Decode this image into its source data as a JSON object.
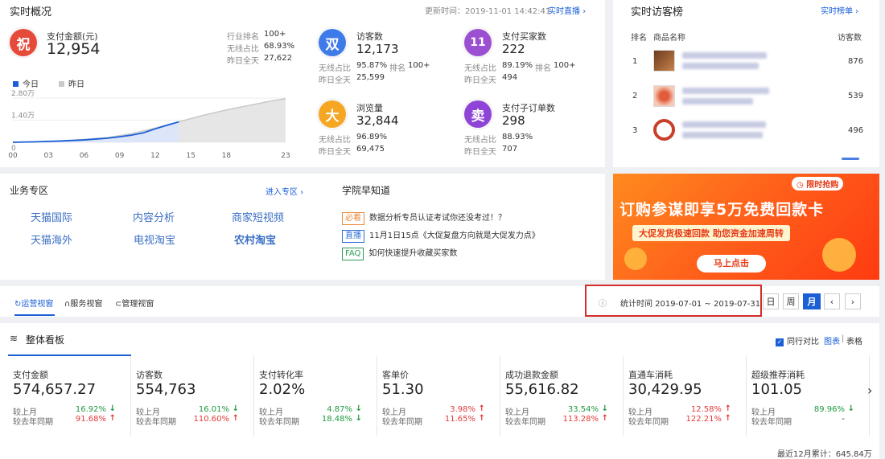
{
  "realtime": {
    "title": "实时概况",
    "updated": "更新时间：2019-11-01 14:42:41",
    "live_link": "实时直播",
    "pay_amount_label": "支付金额(元)",
    "pay_amount_value": "12,954",
    "industry_rank_label": "行业排名",
    "industry_rank_value": "100+",
    "wireless_label": "无线占比",
    "wireless_value": "68.93%",
    "yesterday_label": "昨日全天",
    "yesterday_value": "27,622",
    "legend_today": "今日",
    "legend_yesterday": "昨日",
    "y_ticks": [
      "2.80万",
      "1.40万",
      "0"
    ],
    "x_ticks": [
      "00",
      "03",
      "06",
      "09",
      "12",
      "15",
      "18",
      "23"
    ],
    "metrics": [
      {
        "badge": "双",
        "badge_color": "#3f7be8",
        "label": "访客数",
        "value": "12,173",
        "wl": "无线占比",
        "wv": "95.87%",
        "rl": "排名",
        "rv": "100+",
        "yl": "昨日全天",
        "yv": "25,599"
      },
      {
        "badge": "11",
        "badge_color": "#9b4fd1",
        "label": "支付买家数",
        "value": "222",
        "wl": "无线占比",
        "wv": "89.19%",
        "rl": "排名",
        "rv": "100+",
        "yl": "昨日全天",
        "yv": "494"
      },
      {
        "badge": "大",
        "badge_color": "#f5a623",
        "label": "浏览量",
        "value": "32,844",
        "wl": "无线占比",
        "wv": "96.89%",
        "rl": "",
        "rv": "",
        "yl": "昨日全天",
        "yv": "69,475"
      },
      {
        "badge": "卖",
        "badge_color": "#8e44d6",
        "label": "支付子订单数",
        "value": "298",
        "wl": "无线占比",
        "wv": "88.93%",
        "rl": "",
        "rv": "",
        "yl": "昨日全天",
        "yv": "707"
      }
    ],
    "main_badge": "祝",
    "main_badge_color": "#e64a3b"
  },
  "chart_data": {
    "type": "area",
    "x": [
      "00",
      "03",
      "06",
      "09",
      "12",
      "15",
      "18",
      "23"
    ],
    "ylim": [
      0,
      28000
    ],
    "series": [
      {
        "name": "今日",
        "x": [
          0,
          2,
          4,
          6,
          8,
          9,
          10,
          11,
          12,
          13,
          14
        ],
        "values": [
          0,
          300,
          800,
          1500,
          2600,
          3500,
          4500,
          6000,
          8500,
          10800,
          12954
        ]
      },
      {
        "name": "昨日",
        "x": [
          0,
          2,
          4,
          6,
          8,
          10,
          12,
          14,
          16,
          18,
          20,
          22,
          23
        ],
        "values": [
          0,
          300,
          900,
          1800,
          3000,
          5500,
          9000,
          13000,
          17000,
          20500,
          23500,
          26500,
          27622
        ]
      }
    ]
  },
  "visitors": {
    "title": "实时访客榜",
    "link": "实时榜单",
    "col_rank": "排名",
    "col_name": "商品名称",
    "col_visitors": "访客数",
    "rows": [
      {
        "rank": "1",
        "count": "876"
      },
      {
        "rank": "2",
        "count": "539"
      },
      {
        "rank": "3",
        "count": "496"
      }
    ]
  },
  "business": {
    "title": "业务专区",
    "link": "进入专区",
    "items": [
      "天猫国际",
      "内容分析",
      "商家短视频",
      "天猫海外",
      "电视淘宝",
      "农村淘宝"
    ]
  },
  "academy": {
    "title": "学院早知道",
    "items": [
      {
        "tag": "必看",
        "tag_color": "#e8883a",
        "text": "数据分析专员认证考试你还没考过！？"
      },
      {
        "tag": "直播",
        "tag_color": "#2e6fd8",
        "text": "11月1日15点《大促复盘方向就是大促发力点》"
      },
      {
        "tag": "FAQ",
        "tag_color": "#2e9a52",
        "text": "如何快速提升收藏买家数"
      }
    ]
  },
  "banner": {
    "tag": "限时抢购",
    "headline": "订购参谋即享5万免费回款卡",
    "subline": "大促发货极速回款  助您资金加速周转",
    "cta": "马上点击"
  },
  "views": {
    "tabs": [
      "运营视窗",
      "服务视窗",
      "管理视窗"
    ],
    "stat_time": "统计时间 2019-07-01 ~ 2019-07-31",
    "periods": [
      "日",
      "周",
      "月"
    ],
    "active_period": "月"
  },
  "board": {
    "title": "整体看板",
    "compare_label": "同行对比",
    "chart_label": "图表",
    "table_label": "表格",
    "last_month": "较上月",
    "last_year": "较去年同期",
    "kpis": [
      {
        "title": "支付金额",
        "value": "574,657.27",
        "m": "16.92%",
        "m_dir": "down",
        "y": "91.68%",
        "y_dir": "up"
      },
      {
        "title": "访客数",
        "value": "554,763",
        "m": "16.01%",
        "m_dir": "down",
        "y": "110.60%",
        "y_dir": "up"
      },
      {
        "title": "支付转化率",
        "value": "2.02%",
        "m": "4.87%",
        "m_dir": "down",
        "y": "18.48%",
        "y_dir": "down"
      },
      {
        "title": "客单价",
        "value": "51.30",
        "m": "3.98%",
        "m_dir": "up",
        "y": "11.65%",
        "y_dir": "up"
      },
      {
        "title": "成功退款金额",
        "value": "55,616.82",
        "m": "33.54%",
        "m_dir": "down",
        "y": "113.28%",
        "y_dir": "up"
      },
      {
        "title": "直通车消耗",
        "value": "30,429.95",
        "m": "12.58%",
        "m_dir": "up",
        "y": "122.21%",
        "y_dir": "up"
      },
      {
        "title": "超级推荐消耗",
        "value": "101.05",
        "m": "89.96%",
        "m_dir": "down",
        "y": "-",
        "y_dir": "none"
      }
    ],
    "footer": "最近12月累计：645.84万"
  }
}
